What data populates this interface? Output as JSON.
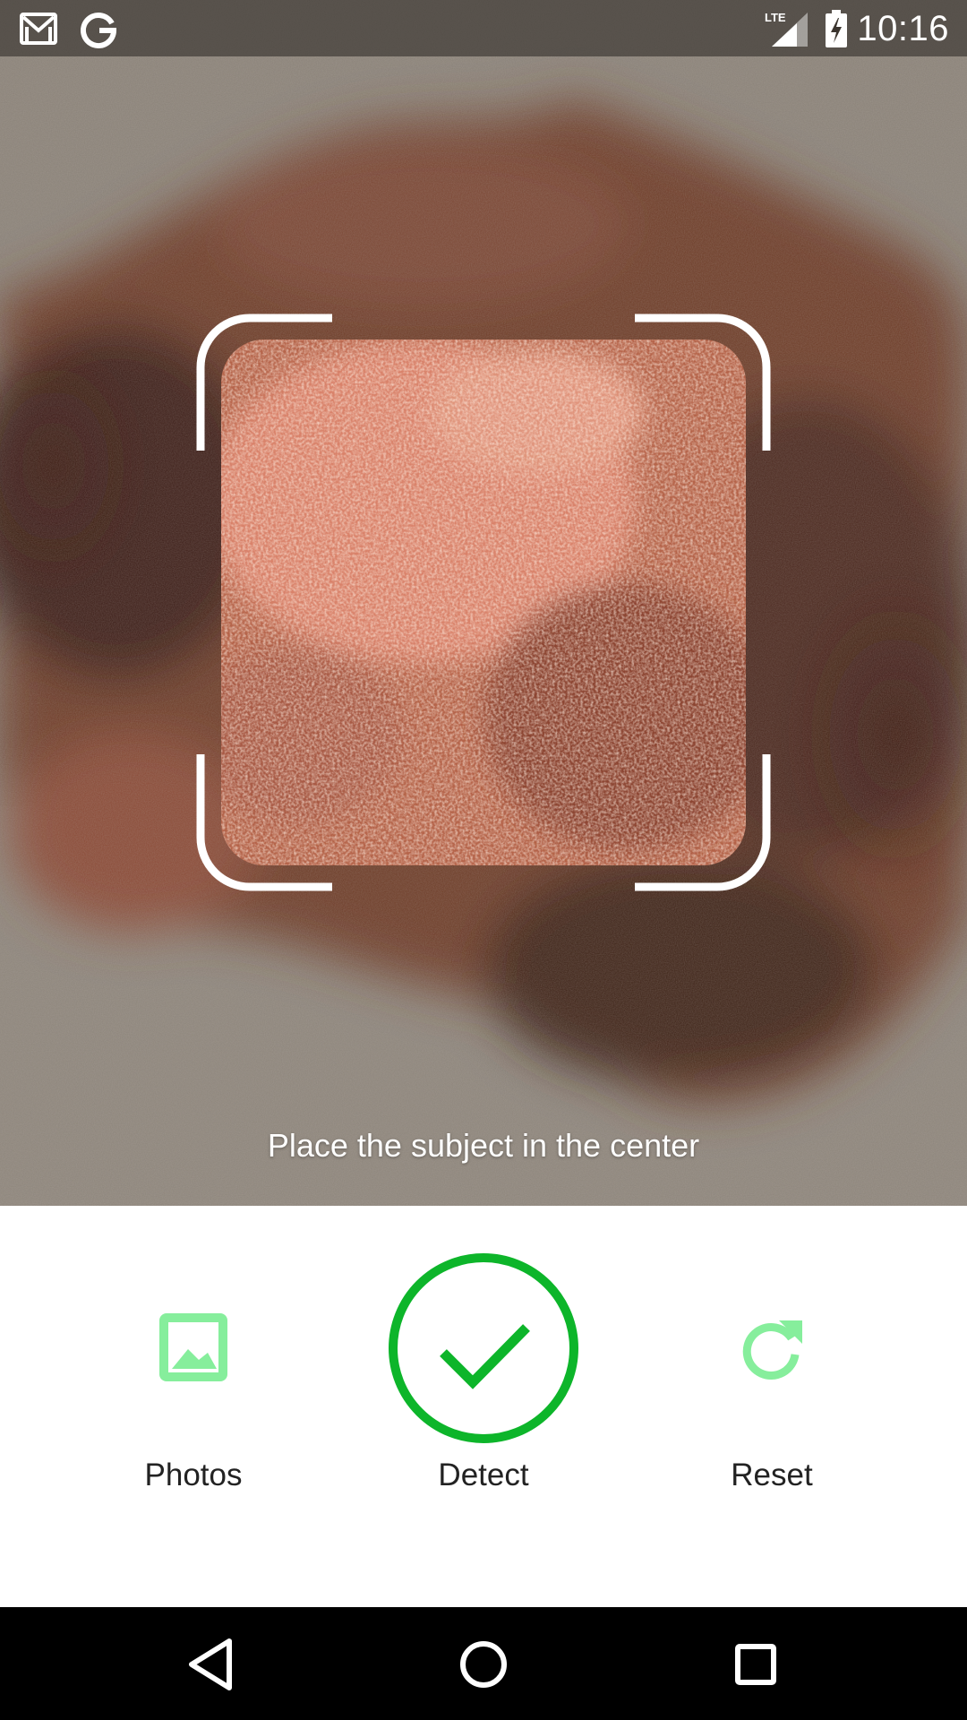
{
  "status_bar": {
    "time": "10:16",
    "network_label": "LTE",
    "icons": [
      "gmail-icon",
      "google-icon",
      "signal-icon",
      "battery-charging-icon"
    ]
  },
  "camera": {
    "hint": "Place the subject in the center",
    "frame_color": "#ffffff"
  },
  "actions": {
    "photos": {
      "label": "Photos",
      "icon": "image-icon"
    },
    "detect": {
      "label": "Detect",
      "icon": "checkmark-icon"
    },
    "reset": {
      "label": "Reset",
      "icon": "refresh-icon"
    }
  },
  "nav": {
    "buttons": [
      "back-icon",
      "home-icon",
      "recents-icon"
    ]
  },
  "colors": {
    "accent": "#0db52a",
    "accent_light": "#86ee9c",
    "nav_bg": "#000000",
    "panel_bg": "#ffffff"
  }
}
